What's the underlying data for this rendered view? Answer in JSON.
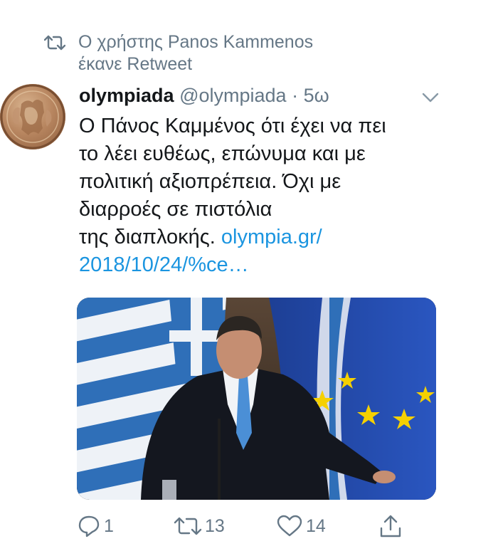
{
  "retweet_context": {
    "line1": "Ο χρήστης Panos Kammenos",
    "line2": "έκανε Retweet",
    "icon": "retweet-icon"
  },
  "tweet": {
    "author_name": "olympiada",
    "handle": "@olympiada",
    "separator": "·",
    "time": "5ω",
    "text_lines": [
      "Ο Πάνος Καμμένος ότι έχει να πει",
      "το λέει ευθέως, επώνυμα και με",
      "πολιτική αξιοπρέπεια. Όχι με",
      "διαρροές σε πιστόλια"
    ],
    "text_tail": "της διαπλοκής. ",
    "link_line1": "olympia.gr/",
    "link_line2": "2018/10/24/%ce…",
    "avatar_icon": "olympic-medallion-avatar",
    "caret_icon": "chevron-down-icon"
  },
  "actions": {
    "reply_count": "1",
    "retweet_count": "13",
    "like_count": "14"
  },
  "colors": {
    "text": "#14171a",
    "muted": "#657786",
    "link": "#1b95e0"
  }
}
